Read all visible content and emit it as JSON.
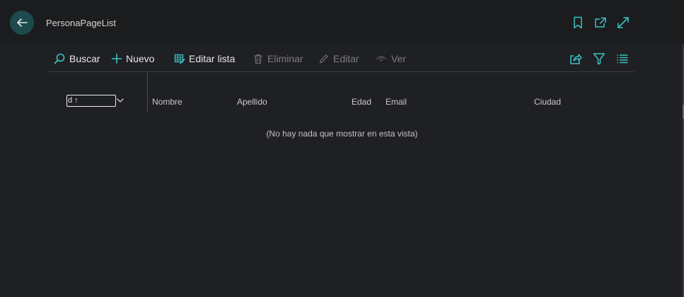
{
  "header": {
    "title": "PersonaPageList"
  },
  "actions": {
    "search": "Buscar",
    "new": "Nuevo",
    "edit_list": "Editar lista",
    "delete": "Eliminar",
    "edit": "Editar",
    "view": "Ver"
  },
  "grid": {
    "sort_field": "d ↑",
    "columns": [
      "Nombre",
      "Apellido",
      "Edad",
      "Email",
      "Ciudad"
    ],
    "empty_message": "(No hay nada que mostrar en esta vista)"
  },
  "colors": {
    "accent": "#3cc2c2",
    "background": "#1f2023",
    "back_button": "#1d4a4d"
  },
  "icons": {
    "back": "arrow-left-icon",
    "bookmark": "bookmark-icon",
    "open_new": "open-in-new-window-icon",
    "expand": "expand-icon",
    "search": "search-icon",
    "new": "plus-icon",
    "edit_list": "edit-list-icon",
    "delete": "trash-icon",
    "edit": "pencil-icon",
    "view": "eye-icon",
    "share": "share-icon",
    "filter": "filter-icon",
    "list": "list-icon"
  }
}
